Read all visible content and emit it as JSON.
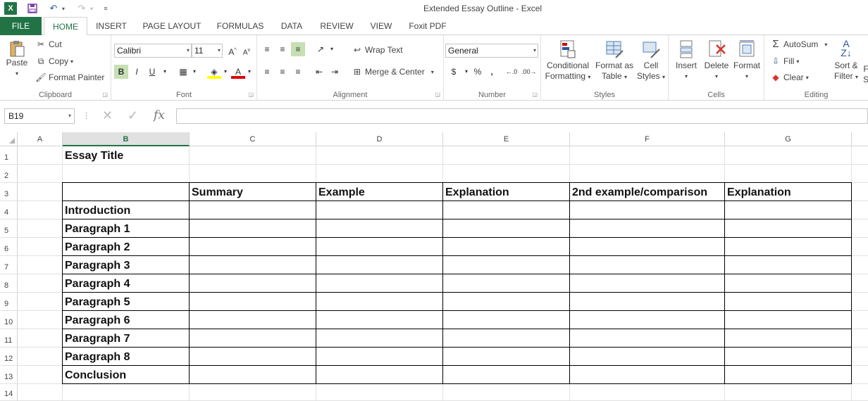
{
  "window": {
    "title": "Extended Essay Outline - Excel",
    "app_icon": "X"
  },
  "quick_access": {
    "save": "💾",
    "undo": "↶",
    "redo": "↷"
  },
  "tabs": [
    {
      "id": "file",
      "label": "FILE"
    },
    {
      "id": "home",
      "label": "HOME",
      "active": true
    },
    {
      "id": "insert",
      "label": "INSERT"
    },
    {
      "id": "pagelayout",
      "label": "PAGE LAYOUT"
    },
    {
      "id": "formulas",
      "label": "FORMULAS"
    },
    {
      "id": "data",
      "label": "DATA"
    },
    {
      "id": "review",
      "label": "REVIEW"
    },
    {
      "id": "view",
      "label": "VIEW"
    },
    {
      "id": "foxit",
      "label": "Foxit PDF"
    }
  ],
  "ribbon": {
    "clipboard": {
      "label": "Clipboard",
      "paste": "Paste",
      "cut": "Cut",
      "copy": "Copy",
      "format_painter": "Format Painter"
    },
    "font": {
      "label": "Font",
      "font_name": "Calibri",
      "font_size": "11",
      "bold": "B",
      "italic": "I",
      "underline": "U"
    },
    "alignment": {
      "label": "Alignment",
      "wrap_text": "Wrap Text",
      "merge_center": "Merge & Center"
    },
    "number": {
      "label": "Number",
      "format": "General",
      "percent": "%",
      "comma": ","
    },
    "styles": {
      "label": "Styles",
      "conditional_1": "Conditional",
      "conditional_2": "Formatting",
      "format_table_1": "Format as",
      "format_table_2": "Table",
      "cell_styles_1": "Cell",
      "cell_styles_2": "Styles"
    },
    "cells": {
      "label": "Cells",
      "insert": "Insert",
      "delete": "Delete",
      "format": "Format"
    },
    "editing": {
      "label": "Editing",
      "autosum": "AutoSum",
      "fill": "Fill",
      "clear": "Clear",
      "sort_1": "Sort &",
      "sort_2": "Filter",
      "find_1": "F",
      "find_2": "S"
    }
  },
  "formula_bar": {
    "name_box": "B19",
    "fx": "fx",
    "value": ""
  },
  "columns": [
    "A",
    "B",
    "C",
    "D",
    "E",
    "F",
    "G"
  ],
  "active_column": "B",
  "rows": [
    "1",
    "2",
    "3",
    "4",
    "5",
    "6",
    "7",
    "8",
    "9",
    "10",
    "11",
    "12",
    "13",
    "14"
  ],
  "cells": {
    "B1": "Essay Title",
    "headers": [
      "Summary",
      "Example",
      "Explanation",
      "2nd example/comparison",
      "Explanation"
    ],
    "row_labels": [
      "Introduction",
      "Paragraph 1",
      "Paragraph 2",
      "Paragraph 3",
      "Paragraph 4",
      "Paragraph 5",
      "Paragraph 6",
      "Paragraph 7",
      "Paragraph 8",
      "Conclusion"
    ]
  }
}
